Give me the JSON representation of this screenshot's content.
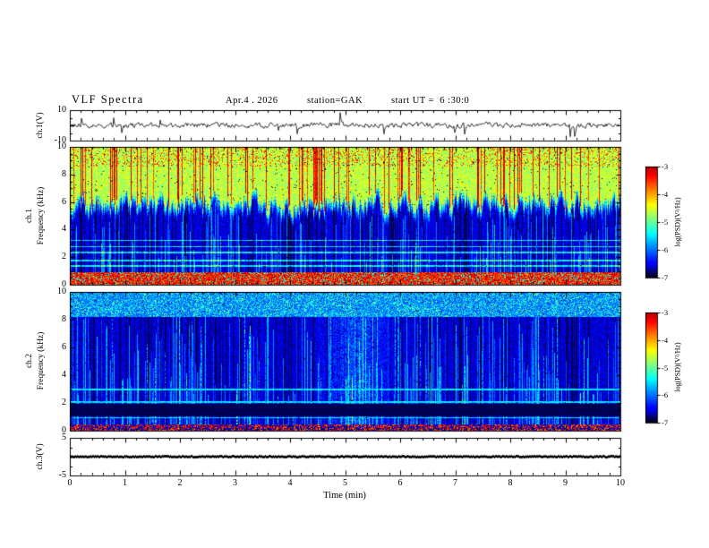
{
  "header": {
    "title": "VLF Spectra",
    "date": "Apr.4 . 2026",
    "station": "station=GAK",
    "start_ut": "start UT =  6 :30:0"
  },
  "xaxis": {
    "label": "Time (min)",
    "lim": [
      0,
      10
    ],
    "tick_labels": [
      "0",
      "1",
      "2",
      "3",
      "4",
      "5",
      "6",
      "7",
      "8",
      "9",
      "10"
    ]
  },
  "chart_data": [
    {
      "type": "line",
      "name": "ch.1 voltage waveform",
      "ylabel": "ch.1(V)",
      "ylim": [
        -10,
        10
      ],
      "ytick_labels": [
        "10",
        "-10"
      ],
      "description": "Broadband noise trace around 0 V (~±2 V) with intermittent impulsive spikes reaching ±9 V across 0–10 min"
    },
    {
      "type": "heatmap",
      "name": "ch.1 spectrogram",
      "channel_label": "ch.1",
      "ylabel": "Frequency (kHz)",
      "ylim": [
        0,
        10
      ],
      "ytick_labels": [
        "0",
        "2",
        "4",
        "6",
        "8",
        "10"
      ],
      "colormap": "jet",
      "colorbar": {
        "label": "log(PSD)(V²/Hz)",
        "tick_labels": [
          "-3",
          "-4",
          "-5",
          "-6",
          "-7"
        ],
        "range": [
          -7,
          -3
        ]
      },
      "features": {
        "strong_low_band_khz": [
          0,
          0.85
        ],
        "horizontal_lines_khz": [
          1.35,
          1.75,
          2.3,
          2.75,
          3.2
        ],
        "active_region_boundary_khz": [
          4.5,
          7.5
        ],
        "hot_column_fraction": 0.16,
        "noise_floor_logpsd": -6.7,
        "active_region_logpsd": -4.5
      }
    },
    {
      "type": "heatmap",
      "name": "ch.2 spectrogram",
      "channel_label": "ch.2",
      "ylabel": "Frequency (kHz)",
      "ylim": [
        0,
        10
      ],
      "ytick_labels": [
        "0",
        "2",
        "4",
        "6",
        "8",
        "10"
      ],
      "colormap": "jet",
      "colorbar": {
        "label": "log(PSD)(V²/Hz)",
        "tick_labels": [
          "-3",
          "-4",
          "-5",
          "-6",
          "-7"
        ],
        "range": [
          -7,
          -3
        ]
      },
      "features": {
        "bottom_band_khz": [
          0,
          0.45
        ],
        "dark_band_khz": [
          1.0,
          1.9
        ],
        "horizontal_lines_khz": [
          0.9,
          2.05,
          2.95
        ],
        "top_speckle_band_khz": [
          8.2,
          10
        ],
        "streak_column_fraction": 0.33,
        "event_time_min": 5.2,
        "noise_floor_logpsd": -6.7
      }
    },
    {
      "type": "line",
      "name": "ch.3 voltage waveform",
      "ylabel": "ch.3(V)",
      "ylim": [
        -5,
        5
      ],
      "ytick_labels": [
        "5",
        "-5"
      ],
      "description": "Flat thick trace at 0 V for entire record"
    }
  ],
  "colors": {
    "background": "#ffffff",
    "axis": "#000000",
    "trace": "#000000"
  }
}
